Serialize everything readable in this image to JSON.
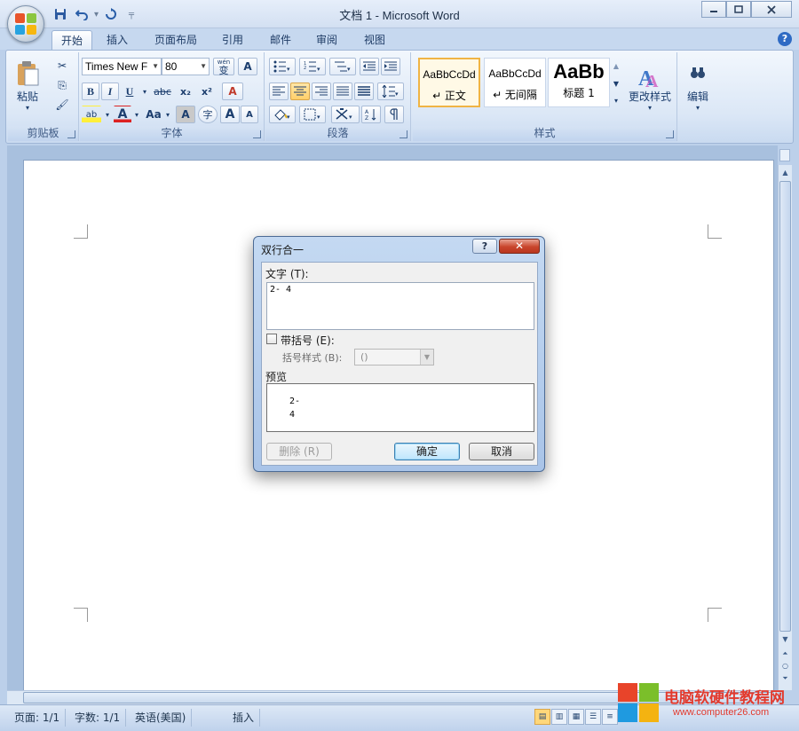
{
  "window": {
    "title": "文档 1 - Microsoft Word",
    "minimize_label": "▭",
    "maximize_label": "□",
    "close_label": "✕"
  },
  "qat": {
    "save_icon": "save-icon",
    "undo_icon": "undo-icon",
    "redo_icon": "redo-icon",
    "customize_icon": "customize-arrow-icon"
  },
  "tabs": [
    "开始",
    "插入",
    "页面布局",
    "引用",
    "邮件",
    "审阅",
    "视图"
  ],
  "active_tab": "开始",
  "ribbon": {
    "clipboard": {
      "label": "剪贴板",
      "paste_label": "粘贴",
      "paste_arrow": "▾",
      "cut_icon": "✂",
      "copy_icon": "⎘",
      "format_painter_icon": "🖌"
    },
    "font": {
      "label": "字体",
      "font_name": "Times New F",
      "font_size": "80",
      "phonetic_label": "wén",
      "phonetic_char": "变",
      "border_char": "A",
      "bold": "B",
      "italic": "I",
      "underline": "U",
      "strikethrough": "abc",
      "subscript": "x₂",
      "superscript": "x²",
      "clear_format": "A",
      "highlight": "ab",
      "font_color": "A",
      "change_case": "Aa",
      "char_shading": "A",
      "enclose_char": "字",
      "grow_font": "A",
      "shrink_font": "A"
    },
    "paragraph": {
      "label": "段落"
    },
    "styles": {
      "label": "样式",
      "items": [
        {
          "sample": "AaBbCcDd",
          "name": "↵ 正文"
        },
        {
          "sample": "AaBbCcDd",
          "name": "↵ 无间隔"
        },
        {
          "sample": "AaBb",
          "name": "标题 1"
        }
      ],
      "change_styles_label": "更改样式",
      "change_styles_arrow": "▾"
    },
    "editing": {
      "label": "编辑",
      "arrow": "▾"
    }
  },
  "statusbar": {
    "page": "页面: 1/1",
    "words": "字数: 1/1",
    "language": "英语(美国)",
    "insert_mode": "插入"
  },
  "watermark": {
    "title": "电脑软硬件教程网",
    "url": "www.computer26.com"
  },
  "dialog": {
    "title": "双行合一",
    "help_label": "?",
    "close_label": "✕",
    "text_label": "文字 (T):",
    "text_value": "2- 4",
    "bracket_checkbox_label": "带括号 (E):",
    "bracket_checked": false,
    "bracket_style_label": "括号样式 (B):",
    "bracket_style_value": "()",
    "preview_label": "预览",
    "preview_line1": "2-",
    "preview_line2": "4",
    "delete_label": "删除 (R)",
    "ok_label": "确定",
    "cancel_label": "取消"
  }
}
